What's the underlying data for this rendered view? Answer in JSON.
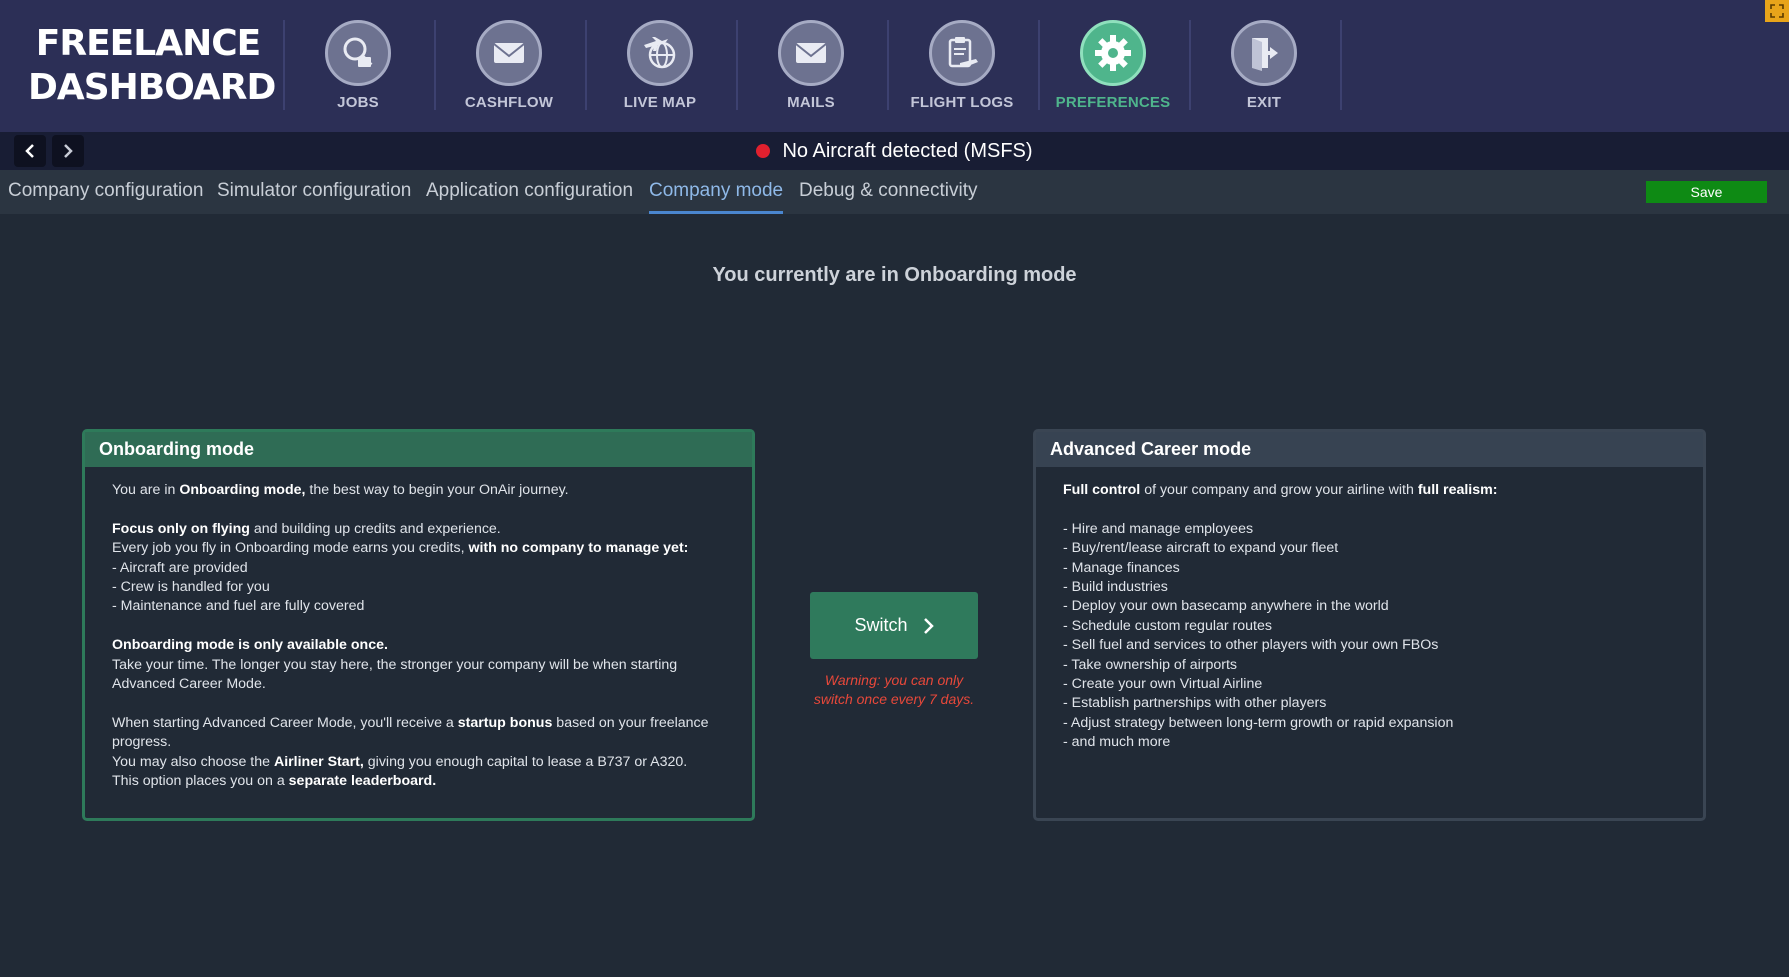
{
  "app": {
    "logo_line1": "FREELANCE",
    "logo_line2": "DASHBOARD"
  },
  "nav": [
    {
      "label": "JOBS",
      "icon": "jobs-search-icon"
    },
    {
      "label": "CASHFLOW",
      "icon": "envelope-icon"
    },
    {
      "label": "LIVE MAP",
      "icon": "globe-plane-icon"
    },
    {
      "label": "MAILS",
      "icon": "envelope-icon"
    },
    {
      "label": "FLIGHT LOGS",
      "icon": "clipboard-plane-icon"
    },
    {
      "label": "PREFERENCES",
      "icon": "gear-icon",
      "active": true
    },
    {
      "label": "EXIT",
      "icon": "exit-door-icon"
    }
  ],
  "status": {
    "text": "No Aircraft detected (MSFS)",
    "indicator_color": "#e0202e"
  },
  "tabs": [
    {
      "label": "Company configuration"
    },
    {
      "label": "Simulator configuration"
    },
    {
      "label": "Application configuration"
    },
    {
      "label": "Company mode",
      "active": true
    },
    {
      "label": "Debug & connectivity"
    }
  ],
  "save_label": "Save",
  "heading": "You currently are in Onboarding mode",
  "onboarding": {
    "title": "Onboarding mode",
    "l1a": "You are in ",
    "l1b": "Onboarding mode,",
    "l1c": " the best way to begin your OnAir journey.",
    "l2a": "Focus only on flying",
    "l2b": " and building up credits and experience.",
    "l3a": "Every job you fly in Onboarding mode earns you credits, ",
    "l3b": "with no company to manage yet:",
    "l4": "- Aircraft are provided",
    "l5": "- Crew is handled for you",
    "l6": "- Maintenance and fuel are fully covered",
    "l7": "Onboarding mode is only available once.",
    "l8": "Take your time. The longer you stay here, the stronger your company will be when starting Advanced Career Mode.",
    "l9a": "When starting Advanced Career Mode, you'll receive a ",
    "l9b": "startup bonus",
    "l9c": " based on your freelance progress.",
    "l10a": "You may also choose the ",
    "l10b": "Airliner Start,",
    "l10c": " giving you enough capital to lease a B737 or A320.",
    "l11a": "This option places you on a ",
    "l11b": "separate leaderboard."
  },
  "switch": {
    "label": "Switch",
    "warning_line1": "Warning: you can only",
    "warning_line2": "switch once every 7 days."
  },
  "advanced": {
    "title": "Advanced Career mode",
    "l1a": "Full control",
    "l1b": " of your company and grow your airline with ",
    "l1c": "full realism:",
    "items": [
      "- Hire and manage employees",
      "- Buy/rent/lease aircraft to expand your fleet",
      "- Manage finances",
      "- Build industries",
      "- Deploy your own basecamp anywhere in the world",
      "- Schedule custom regular routes",
      "- Sell fuel and services to other players with your own FBOs",
      "- Take ownership of airports",
      "- Create your own Virtual Airline",
      "- Establish partnerships with other players",
      "- Adjust strategy between long-term growth or rapid expansion",
      "- and much more"
    ]
  },
  "colors": {
    "header_bg": "#2c2f56",
    "accent_green": "#4fb58c",
    "save_green": "#0e8a14",
    "warning_red": "#e8483a"
  }
}
